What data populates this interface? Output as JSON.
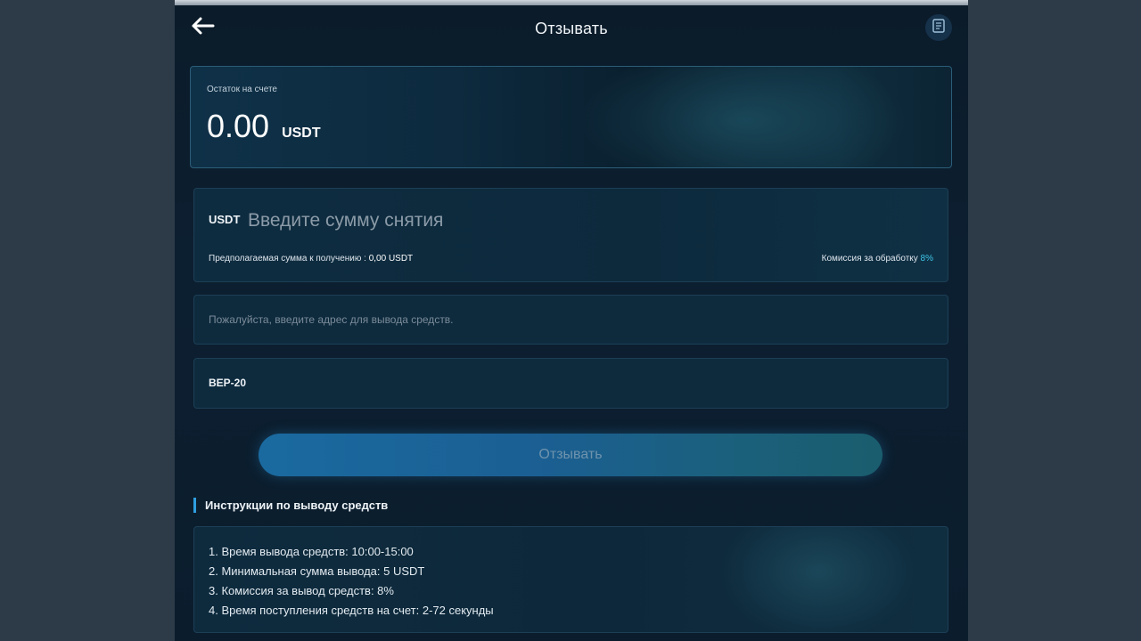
{
  "header": {
    "title": "Отзывать",
    "back_icon": "arrow-left-icon",
    "record_icon": "document-icon"
  },
  "balance": {
    "label": "Остаток на счете",
    "amount": "0.00",
    "currency": "USDT"
  },
  "amount_field": {
    "currency": "USDT",
    "placeholder": "Введите сумму снятия",
    "value": "",
    "expected_label": "Предполагаемая сумма к получению : ",
    "expected_value": "0,00 USDT",
    "commission_label": "Комиссия за обработку ",
    "commission_value": "8%"
  },
  "address_field": {
    "placeholder": "Пожалуйста, введите адрес для вывода средств.",
    "value": ""
  },
  "network_select": {
    "selected": "BEP-20"
  },
  "submit": {
    "label": "Отзывать"
  },
  "instructions": {
    "title": "Инструкции по выводу средств",
    "items": [
      "1. Время вывода средств: 10:00-15:00",
      "2. Минимальная сумма вывода: 5 USDT",
      "3. Комиссия за вывод средств: 8%",
      "4. Время поступления средств на счет: 2-72 секунды"
    ]
  },
  "colors": {
    "accent": "#2f9fe0",
    "commission": "#3fc3e8",
    "page_background": "#2d3a48",
    "screen_background": "#0b1b2a"
  }
}
